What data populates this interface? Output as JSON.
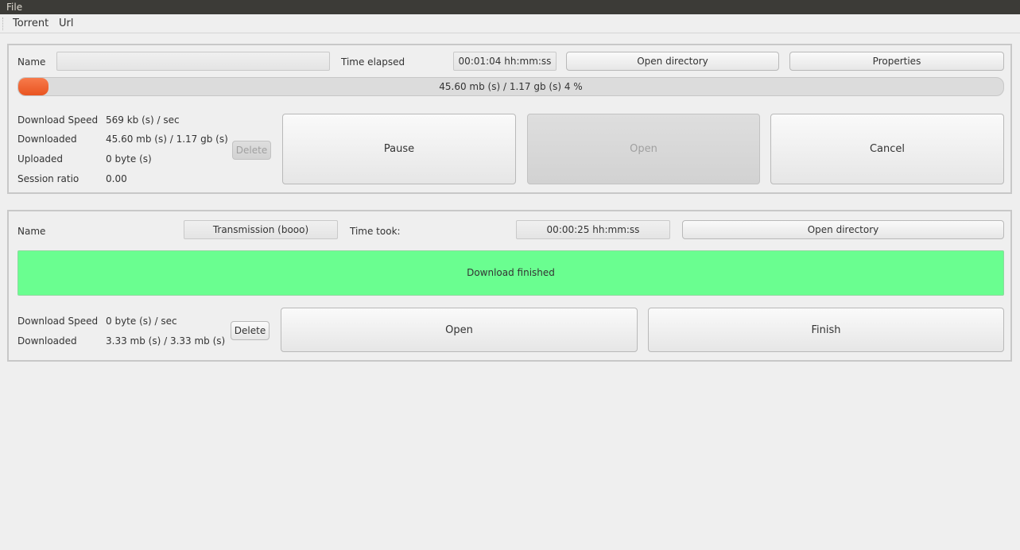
{
  "window": {
    "title": "File"
  },
  "menu": {
    "items": [
      "Torrent",
      "Url"
    ]
  },
  "active_download": {
    "name_label": "Name",
    "name_value": "",
    "time_label": "Time elapsed",
    "time_value": "00:01:04 hh:mm:ss",
    "open_directory_label": "Open directory",
    "properties_label": "Properties",
    "progress_percent": 4,
    "progress_text": "45.60 mb (s) / 1.17 gb (s) 4 %",
    "stats": [
      {
        "label": "Download Speed",
        "value": "569 kb (s) / sec"
      },
      {
        "label": "Downloaded",
        "value": "45.60 mb (s) / 1.17 gb (s)"
      },
      {
        "label": "Uploaded",
        "value": "0 byte (s)"
      },
      {
        "label": "Session ratio",
        "value": "0.00"
      }
    ],
    "delete_label": "Delete",
    "pause_label": "Pause",
    "open_label": "Open",
    "cancel_label": "Cancel"
  },
  "finished_download": {
    "name_label": "Name",
    "name_value": "Transmission (booo)",
    "time_label": "Time took:",
    "time_value": "00:00:25 hh:mm:ss",
    "open_directory_label": "Open directory",
    "status_text": "Download finished",
    "stats": [
      {
        "label": "Download Speed",
        "value": "0 byte (s) / sec"
      },
      {
        "label": "Downloaded",
        "value": "3.33 mb (s) / 3.33 mb (s)"
      }
    ],
    "delete_label": "Delete",
    "open_label": "Open",
    "finish_label": "Finish"
  },
  "colors": {
    "progress_fill": "#e95420",
    "finished_bg": "#6afe90",
    "titlebar_bg": "#3c3b37"
  }
}
